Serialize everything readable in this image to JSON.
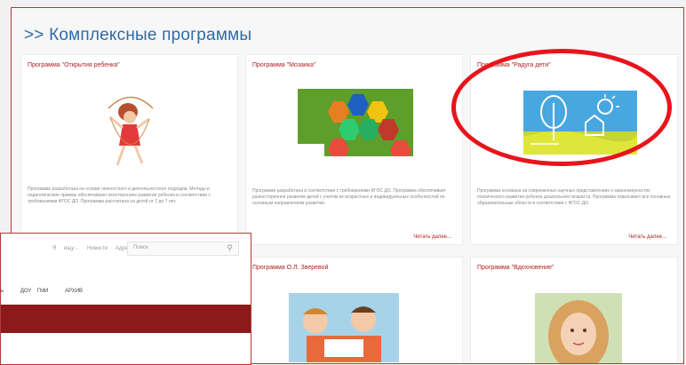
{
  "page": {
    "section_title": ">> Комплексные программы"
  },
  "cards": [
    {
      "title": "Программа \"Открытия ребенка\"",
      "description": "Программа разработана на основе личностного и деятельностного подходов. Методы и педагогические приемы обеспечивают всестороннее развитие ребенка в соответствии с требованиями ФГОС ДО. Программа рассчитана на детей от 2 до 7 лет.",
      "more": ""
    },
    {
      "title": "Программа \"Мозаика\"",
      "description": "Программа разработана в соответствии с требованиями ФГОС ДО. Программа обеспечивает разностороннее развитие детей с учетом их возрастных и индивидуальных особенностей по основным направлениям развития.",
      "more": "Читать далее..."
    },
    {
      "title": "Программа \"Радуга дети\"",
      "description": "Программа основана на современных научных представлениях о закономерностях психического развития ребенка дошкольного возраста. Программа охватывает все основные образовательные области в соответствии с ФГОС ДО.",
      "more": "Читать далее..."
    },
    {
      "title": "Программа О.Л. Зверевой",
      "description": "",
      "more": ""
    },
    {
      "title": "Программа \"Вдохновение\"",
      "description": "",
      "more": ""
    }
  ],
  "overlay": {
    "top_links": "Я ищу… Новости Адреса",
    "search_placeholder": "Поиск",
    "search_icon": "magnifier-icon",
    "menu_items": [
      "ь",
      "ДОУ ГМИ",
      "АРХИВ"
    ],
    "bar_color": "#8c1a1a"
  },
  "colors": {
    "accent_red": "#b02020",
    "title_blue": "#2f6aa8",
    "highlight": "#e8141c"
  }
}
